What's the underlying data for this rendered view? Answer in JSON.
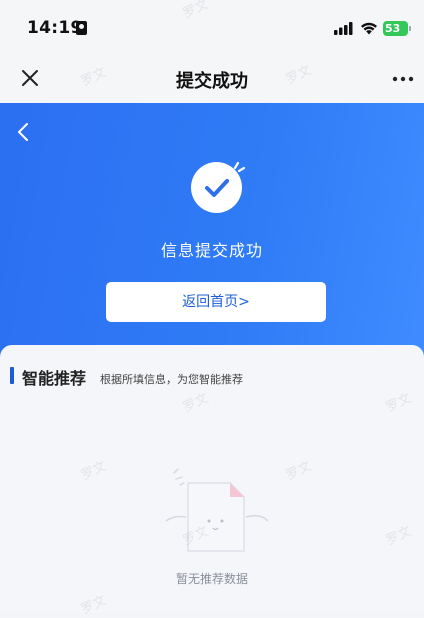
{
  "status_bar": {
    "time": "14:19",
    "battery": "53"
  },
  "nav": {
    "title": "提交成功"
  },
  "hero": {
    "success_text": "信息提交成功",
    "return_button": "返回首页>"
  },
  "recommend": {
    "title": "智能推荐",
    "subtitle": "根据所填信息，为您智能推荐",
    "empty_text": "暂无推荐数据"
  },
  "watermark": "罗文",
  "colors": {
    "accent": "#2c6ff2",
    "battery": "#34c759",
    "section_bar": "#1f5bd6"
  }
}
